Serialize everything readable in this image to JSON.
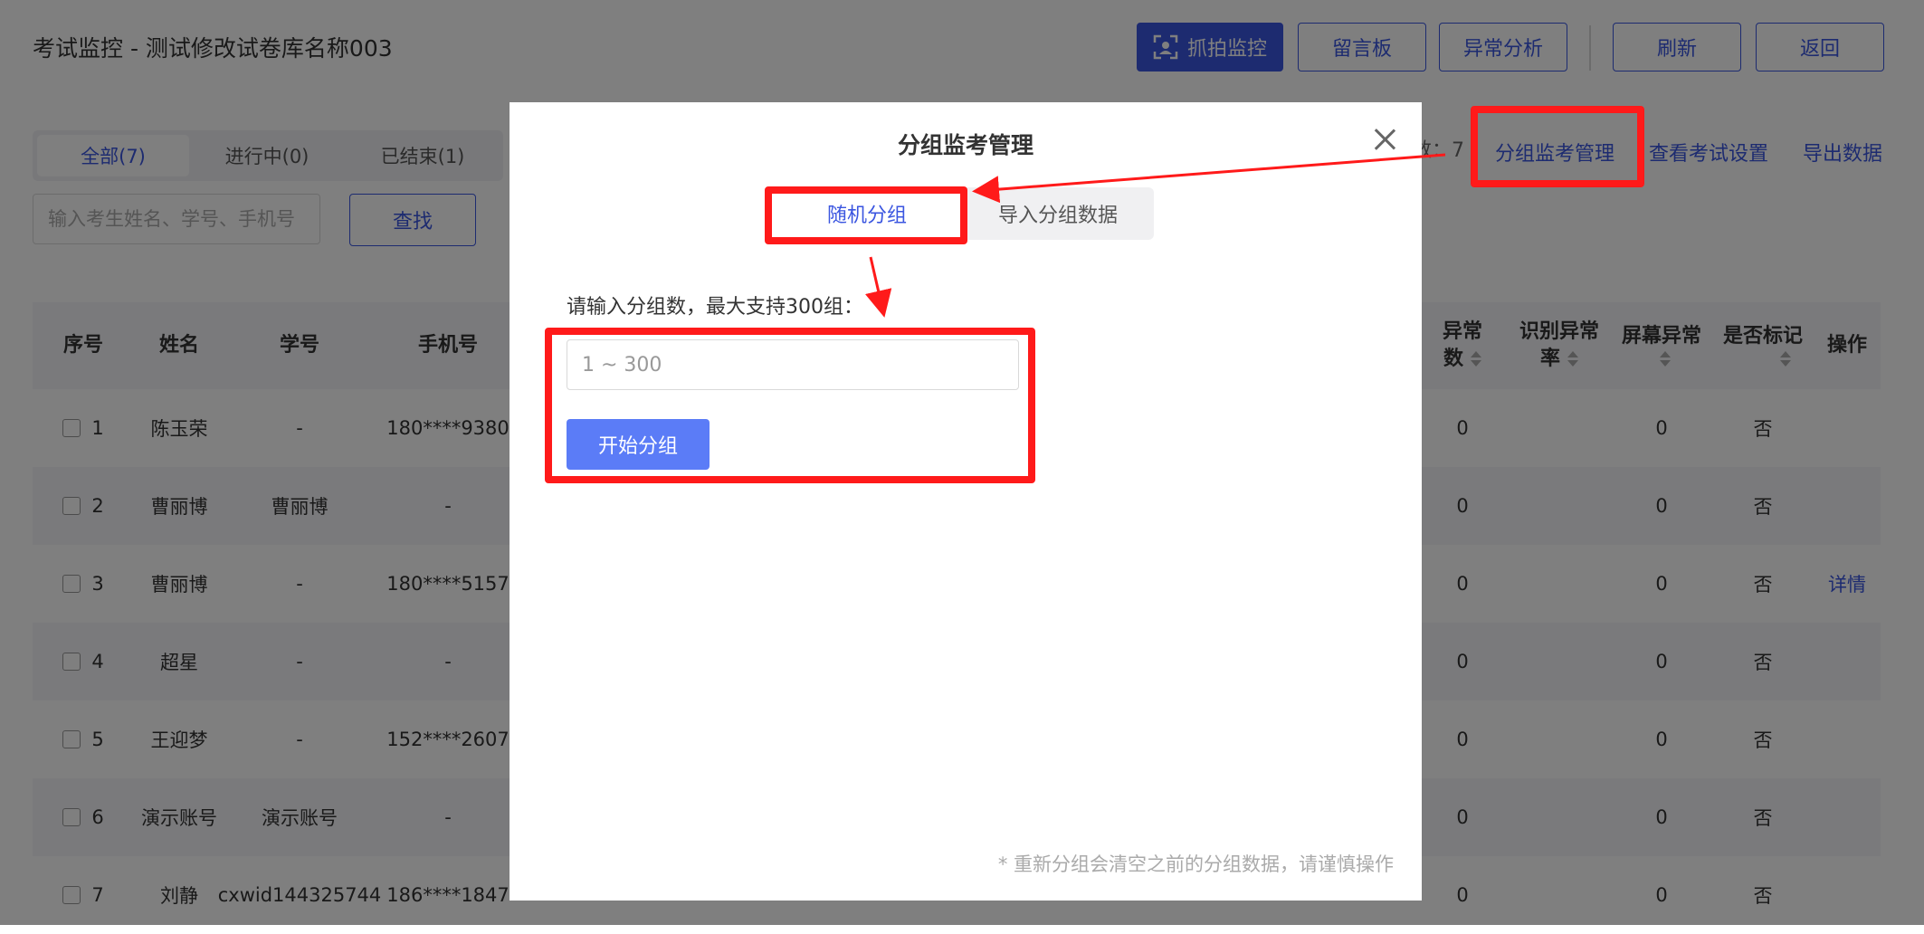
{
  "header": {
    "title": "考试监控 - 测试修改试卷库名称003",
    "buttons": {
      "capture": "抓拍监控",
      "message_board": "留言板",
      "anomaly_analysis": "异常分析",
      "refresh": "刷新",
      "back": "返回"
    }
  },
  "tabs": {
    "all": "全部(7)",
    "in_progress": "进行中(0)",
    "ended": "已结束(1)"
  },
  "toolbar": {
    "count_text": "数：7",
    "group_manage": "分组监考管理",
    "view_settings": "查看考试设置",
    "export": "导出数据"
  },
  "search": {
    "placeholder": "输入考生姓名、学号、手机号",
    "button": "查找"
  },
  "table": {
    "headers": {
      "index": "序号",
      "name": "姓名",
      "student_id": "学号",
      "phone": "手机号",
      "anomaly_count_1": "异常",
      "anomaly_count_2": "数",
      "recog_rate_1": "识别异常",
      "recog_rate_2": "率",
      "screen_anomaly": "屏幕异常",
      "marked": "是否标记",
      "action": "操作"
    },
    "rows": [
      {
        "idx": "1",
        "name": "陈玉荣",
        "sid": "-",
        "phone": "180****9380",
        "anom": "0",
        "screen": "0",
        "marked": "否",
        "action": ""
      },
      {
        "idx": "2",
        "name": "曹丽博",
        "sid": "曹丽博",
        "phone": "-",
        "anom": "0",
        "screen": "0",
        "marked": "否",
        "action": ""
      },
      {
        "idx": "3",
        "name": "曹丽博",
        "sid": "-",
        "phone": "180****5157",
        "anom": "0",
        "screen": "0",
        "marked": "否",
        "action": "详情"
      },
      {
        "idx": "4",
        "name": "超星",
        "sid": "-",
        "phone": "-",
        "anom": "0",
        "screen": "0",
        "marked": "否",
        "action": ""
      },
      {
        "idx": "5",
        "name": "王迎梦",
        "sid": "-",
        "phone": "152****2607",
        "anom": "0",
        "screen": "0",
        "marked": "否",
        "action": ""
      },
      {
        "idx": "6",
        "name": "演示账号",
        "sid": "演示账号",
        "phone": "-",
        "anom": "0",
        "screen": "0",
        "marked": "否",
        "action": ""
      },
      {
        "idx": "7",
        "name": "刘静",
        "sid": "cxwid144325744",
        "phone": "186****1847",
        "anom": "0",
        "screen": "0",
        "marked": "否",
        "action": ""
      }
    ]
  },
  "modal": {
    "title": "分组监考管理",
    "seg_random": "随机分组",
    "seg_import": "导入分组数据",
    "prompt": "请输入分组数，最大支持300组：",
    "input_placeholder": "1 ~ 300",
    "start_button": "开始分组",
    "note": "* 重新分组会清空之前的分组数据，请谨慎操作"
  },
  "colors": {
    "accent": "#3b56e0",
    "primary_button": "#5b7cf7",
    "annotation": "#ff1a1a"
  }
}
